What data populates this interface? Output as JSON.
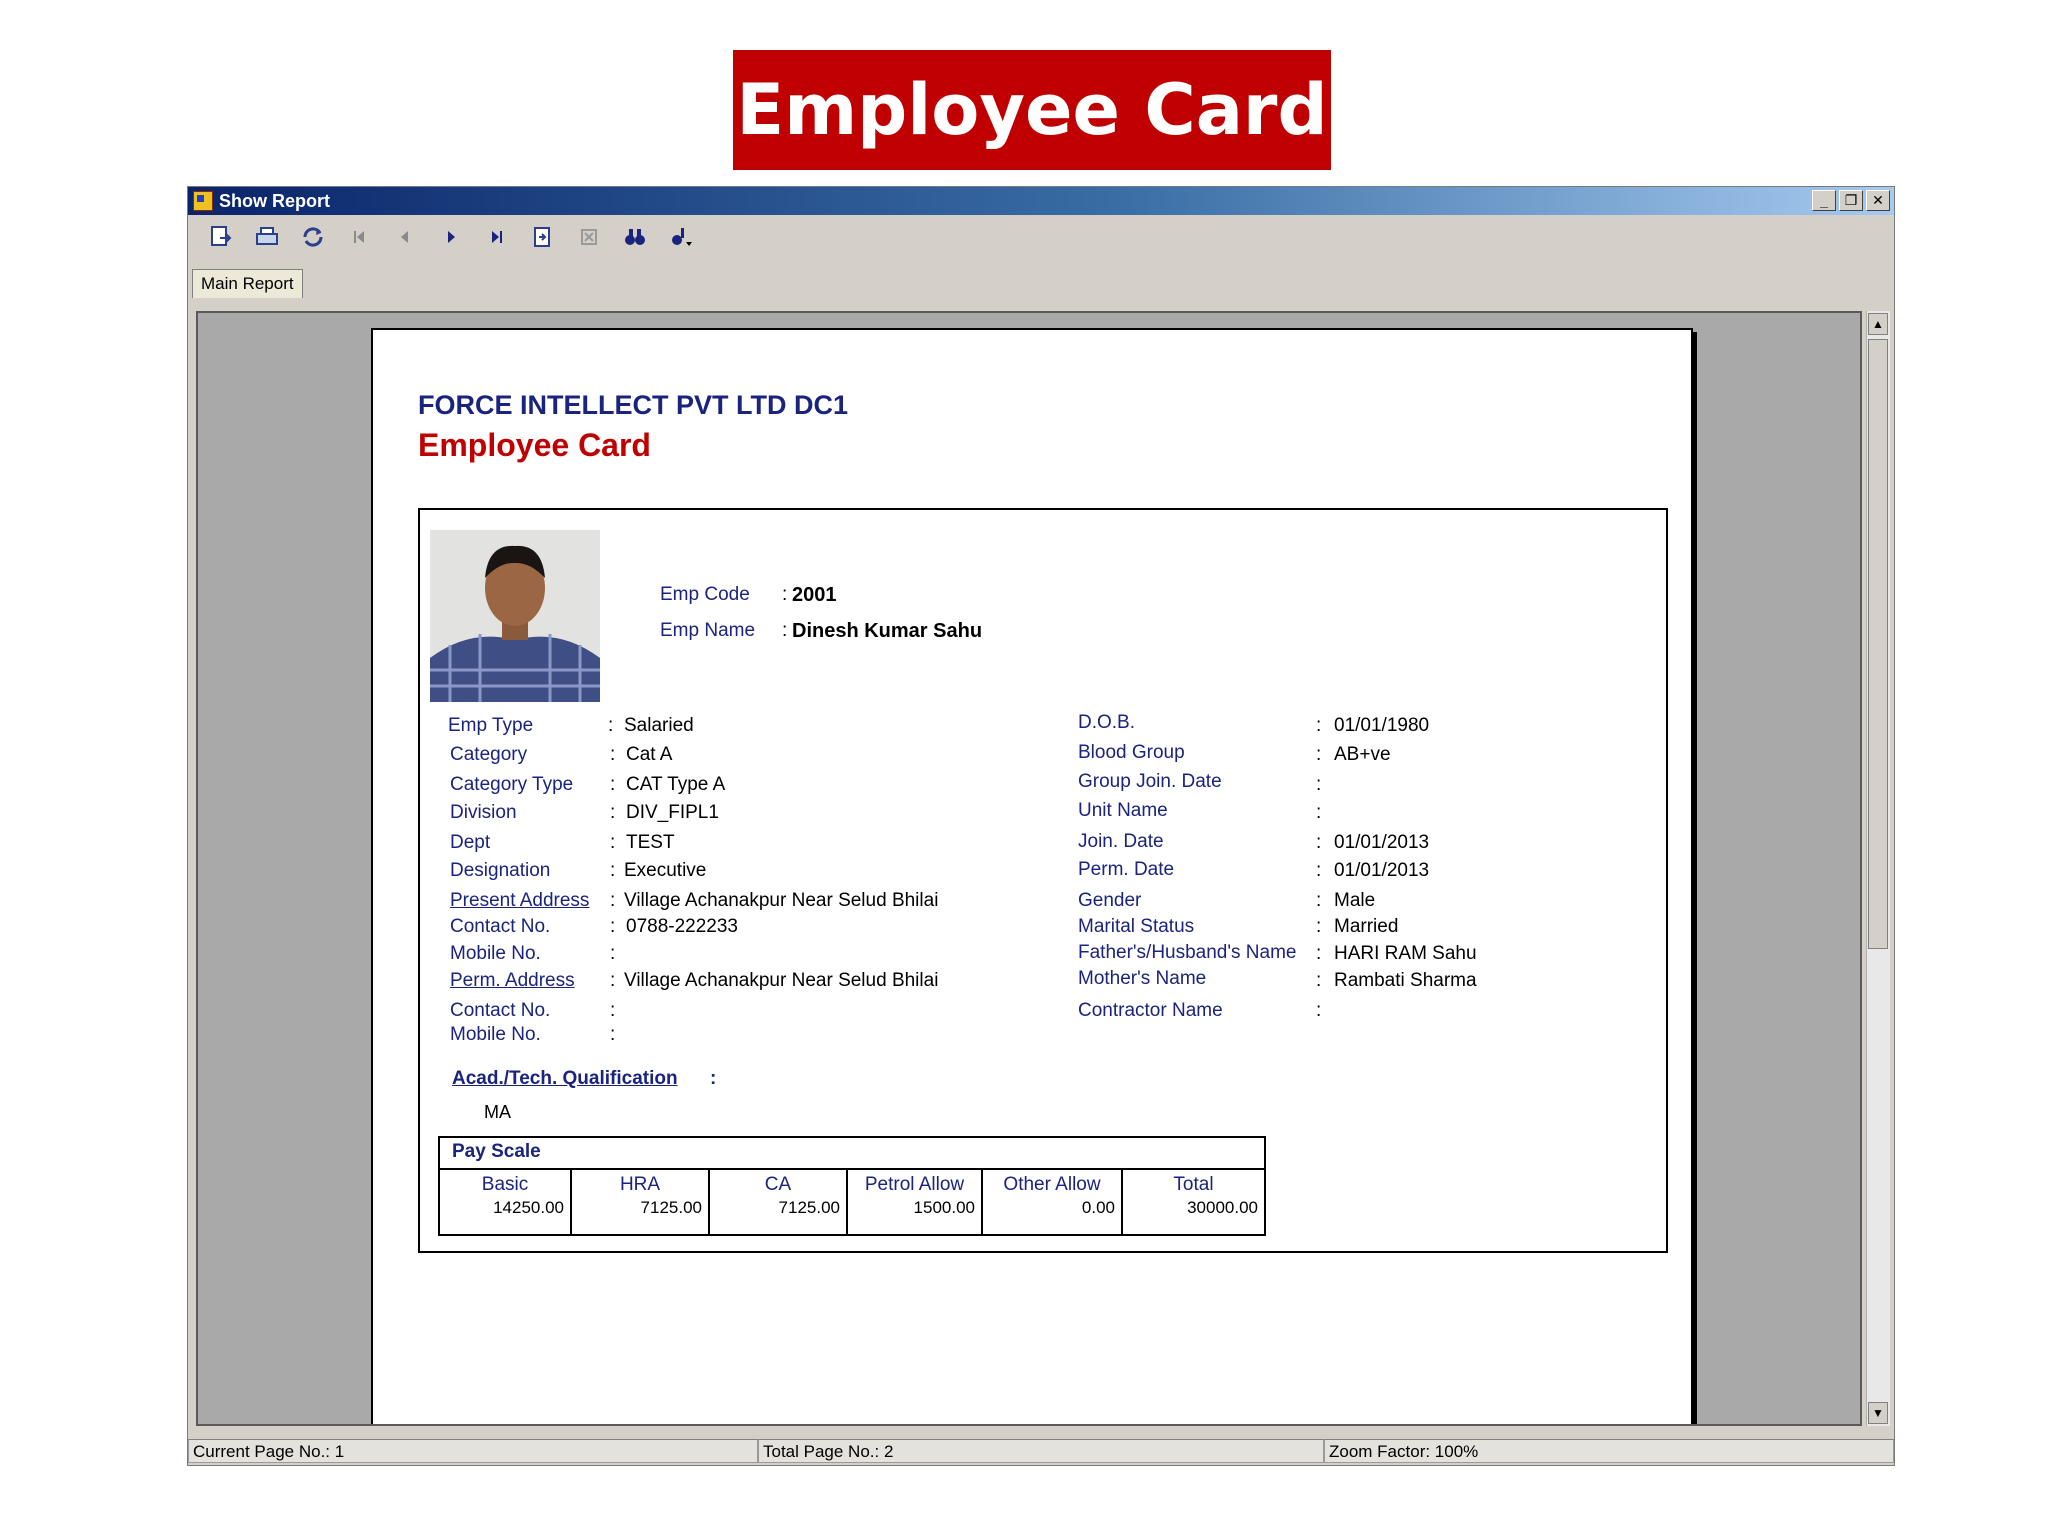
{
  "slide": {
    "title": "Employee Card"
  },
  "window": {
    "title": "Show Report",
    "controls": [
      "minimize-icon",
      "restore-icon",
      "close-icon"
    ]
  },
  "toolbar": {
    "icons": [
      "export-icon",
      "print-icon",
      "refresh-icon",
      "first-page-icon",
      "previous-page-icon",
      "next-page-icon",
      "last-page-icon",
      "goto-page-icon",
      "stop-icon",
      "search-icon",
      "zoom-icon"
    ]
  },
  "tabs": {
    "main": "Main Report"
  },
  "report": {
    "company": "FORCE INTELLECT PVT LTD DC1",
    "title": "Employee Card",
    "emp_code_label": "Emp Code",
    "emp_code": "2001",
    "emp_name_label": "Emp Name",
    "emp_name": "Dinesh Kumar Sahu",
    "left_fields": [
      {
        "label": "Emp Type",
        "value": "Salaried"
      },
      {
        "label": "Category",
        "value": "Cat A"
      },
      {
        "label": "Category Type",
        "value": "CAT Type A"
      },
      {
        "label": "Division",
        "value": "DIV_FIPL1"
      },
      {
        "label": "Dept",
        "value": "TEST"
      },
      {
        "label": "Designation",
        "value": "Executive"
      },
      {
        "label": "Present Address",
        "value": "Village Achanakpur Near Selud Bhilai"
      },
      {
        "label": "Contact No.",
        "value": "0788-222233"
      },
      {
        "label": "Mobile No.",
        "value": ""
      },
      {
        "label": "Perm. Address",
        "value": "Village Achanakpur Near Selud Bhilai"
      },
      {
        "label": "Contact No.",
        "value": ""
      },
      {
        "label": "Mobile No.",
        "value": ""
      }
    ],
    "right_fields": [
      {
        "label": "D.O.B.",
        "value": "01/01/1980"
      },
      {
        "label": "Blood Group",
        "value": "AB+ve"
      },
      {
        "label": "Group Join. Date",
        "value": ""
      },
      {
        "label": "Unit Name",
        "value": ""
      },
      {
        "label": "Join. Date",
        "value": "01/01/2013"
      },
      {
        "label": "Perm. Date",
        "value": "01/01/2013"
      },
      {
        "label": "Gender",
        "value": "Male"
      },
      {
        "label": "Marital Status",
        "value": "Married"
      },
      {
        "label": "Father's/Husband's Name",
        "value": "HARI RAM Sahu"
      },
      {
        "label": "Mother's Name",
        "value": "Rambati Sharma"
      },
      {
        "label": "Contractor Name",
        "value": ""
      }
    ],
    "qualification_label": "Acad./Tech. Qualification",
    "qualification": "MA",
    "pay_scale": {
      "title": "Pay Scale",
      "columns": [
        {
          "header": "Basic",
          "value": "14250.00"
        },
        {
          "header": "HRA",
          "value": "7125.00"
        },
        {
          "header": "CA",
          "value": "7125.00"
        },
        {
          "header": "Petrol Allow",
          "value": "1500.00"
        },
        {
          "header": "Other Allow",
          "value": "0.00"
        },
        {
          "header": "Total",
          "value": "30000.00"
        }
      ]
    }
  },
  "status": {
    "current_page": "Current Page No.: 1",
    "total_page": "Total Page No.: 2",
    "zoom": "Zoom Factor: 100%"
  }
}
